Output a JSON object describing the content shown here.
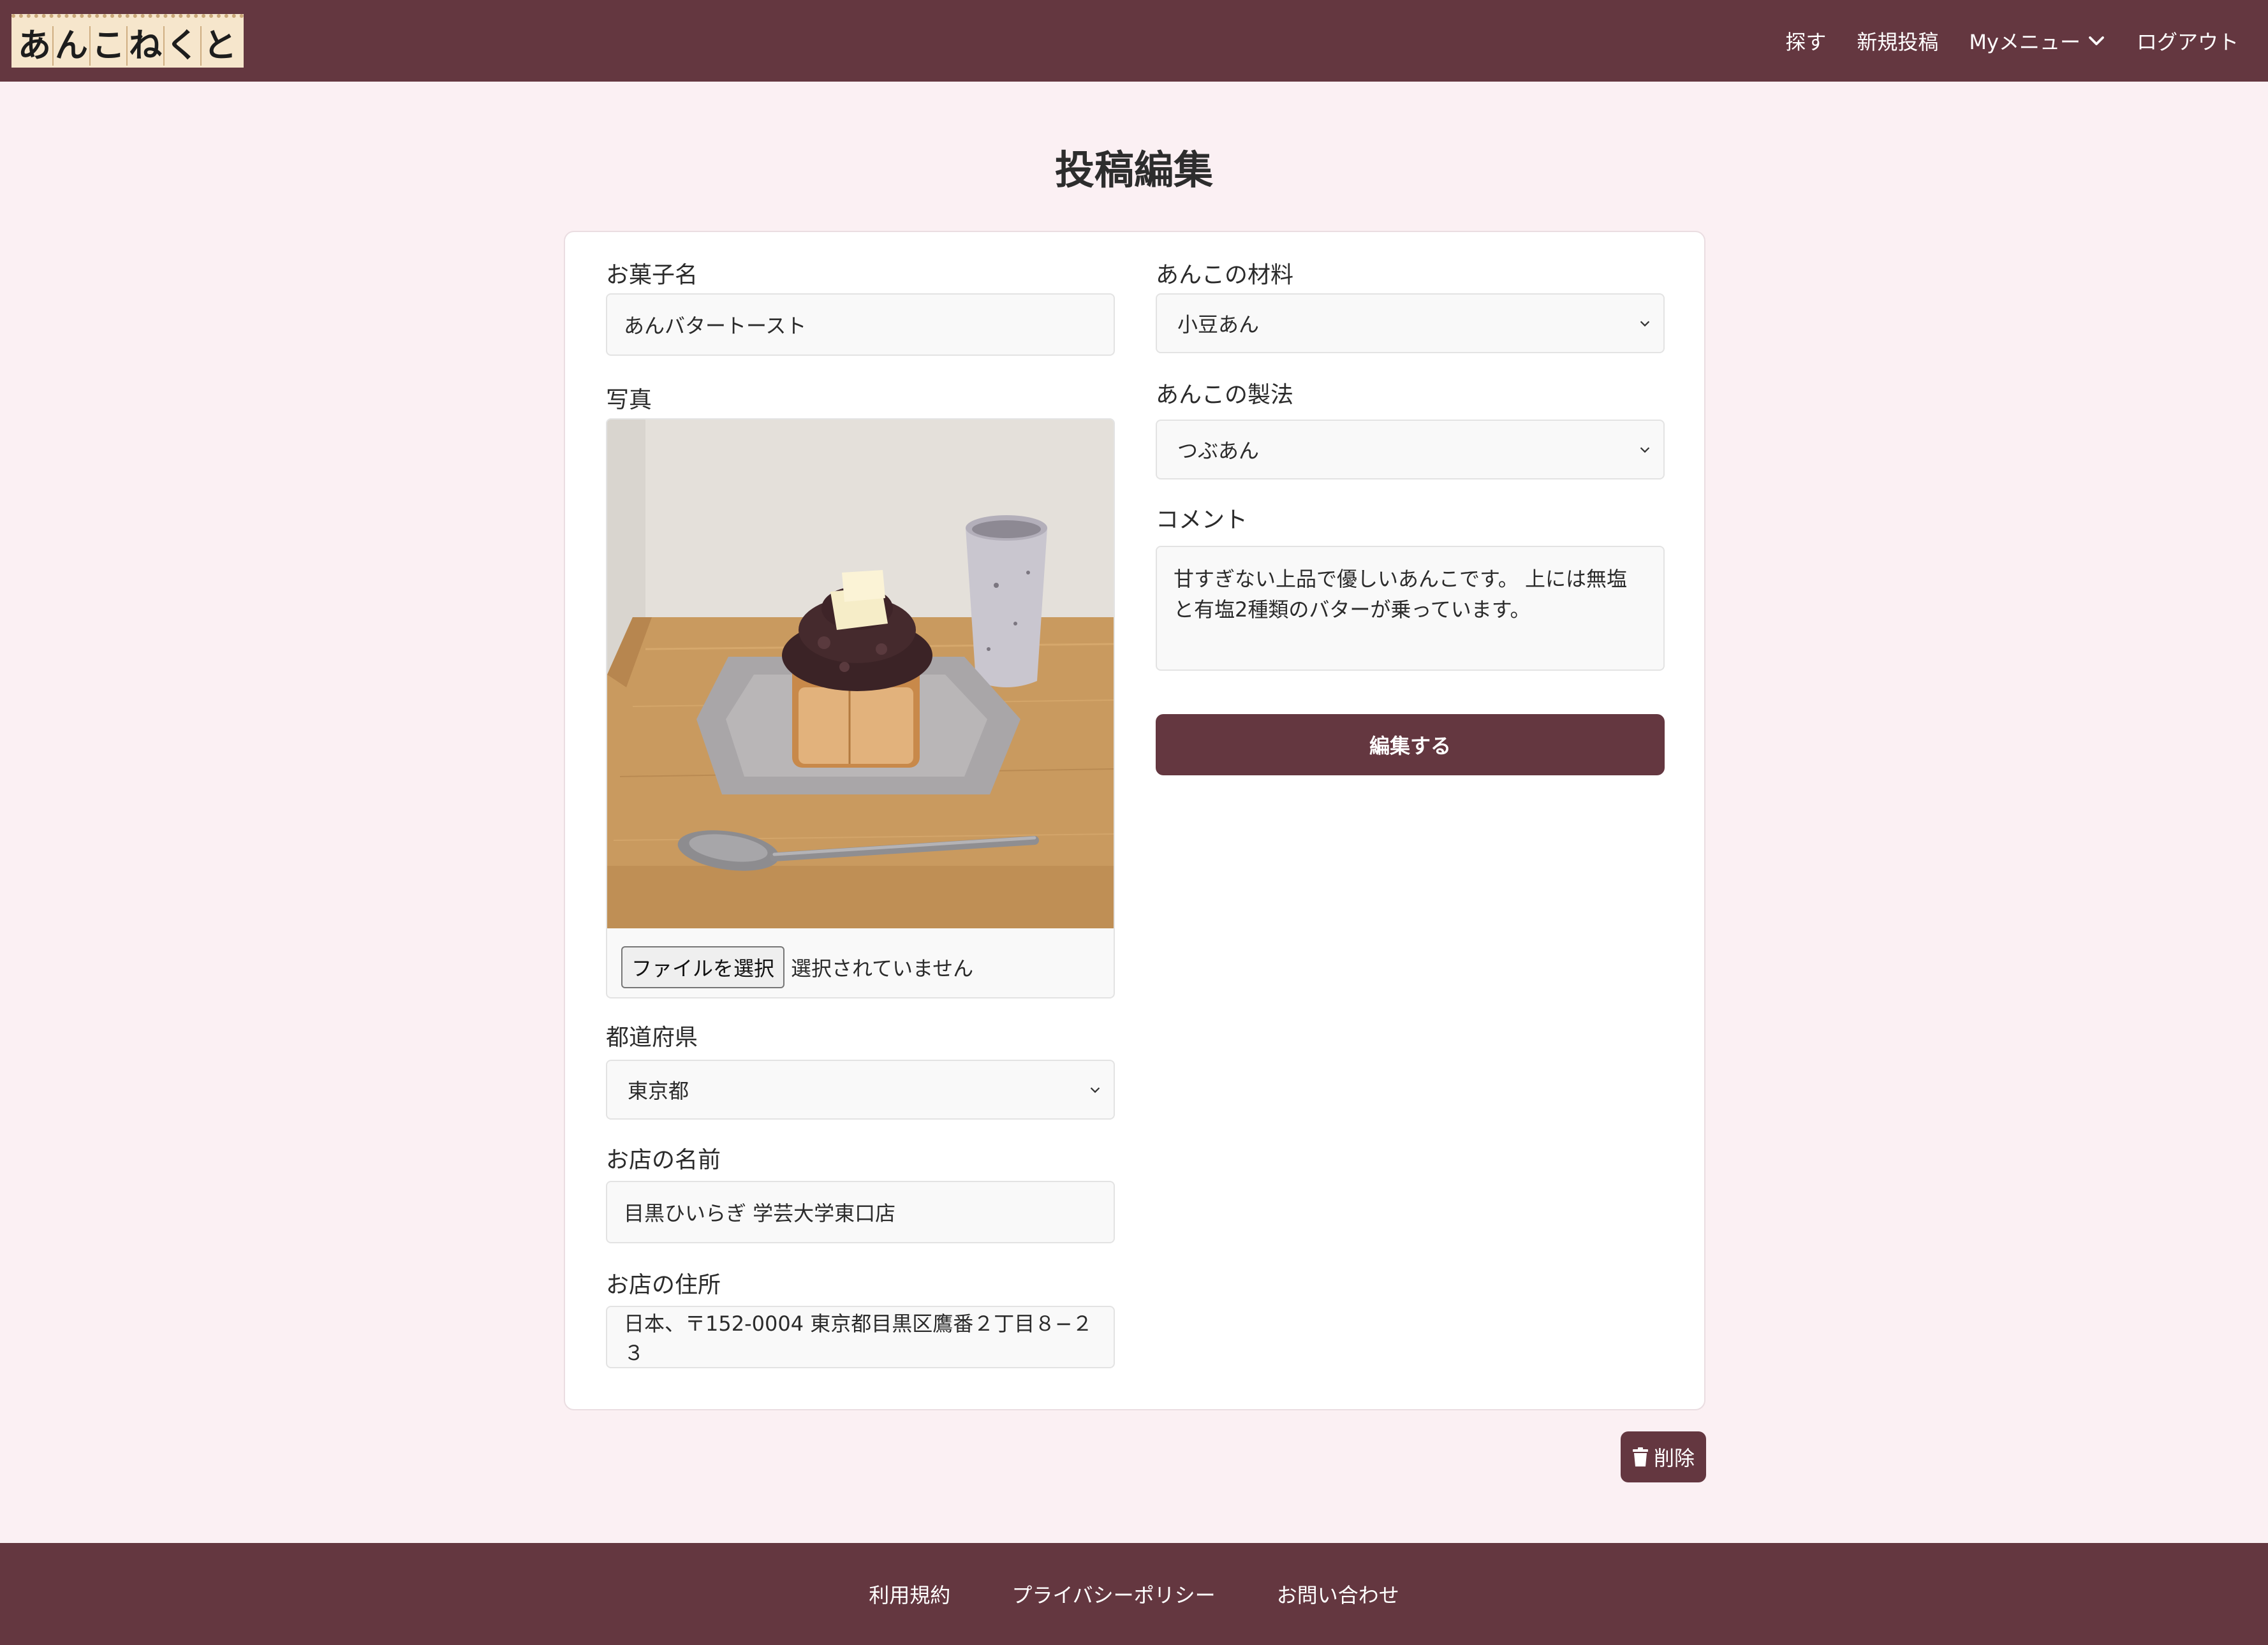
{
  "header": {
    "logo_chars": [
      "あ",
      "ん",
      "こ",
      "ね",
      "く",
      "と"
    ],
    "nav": {
      "search": "探す",
      "new_post": "新規投稿",
      "my_menu": "Myメニュー",
      "logout": "ログアウト"
    }
  },
  "page_title": "投稿編集",
  "form": {
    "sweet_name": {
      "label": "お菓子名",
      "value": "あんバタートースト"
    },
    "photo": {
      "label": "写真",
      "file_button": "ファイルを選択",
      "file_status": "選択されていません"
    },
    "prefecture": {
      "label": "都道府県",
      "value": "東京都"
    },
    "shop_name": {
      "label": "お店の名前",
      "value": "目黒ひいらぎ 学芸大学東口店"
    },
    "shop_address": {
      "label": "お店の住所",
      "value": "日本、〒152-0004 東京都目黒区鷹番２丁目８−２３"
    },
    "anko_material": {
      "label": "あんこの材料",
      "value": "小豆あん"
    },
    "anko_method": {
      "label": "あんこの製法",
      "value": "つぶあん"
    },
    "comment": {
      "label": "コメント",
      "value": "甘すぎない上品で優しいあんこです。 上には無塩と有塩2種類のバターが乗っています。"
    },
    "submit": "編集する"
  },
  "delete_label": "削除",
  "footer": {
    "terms": "利用規約",
    "privacy": "プライバシーポリシー",
    "contact": "お問い合わせ"
  },
  "colors": {
    "brand": "#643740",
    "page_bg": "#fbf0f3",
    "logo_bg": "#f6e6cc"
  },
  "icons": {
    "my_menu_arrow": "chevron-down-icon",
    "select_arrow": "chevron-down-icon",
    "delete": "trash-icon"
  }
}
